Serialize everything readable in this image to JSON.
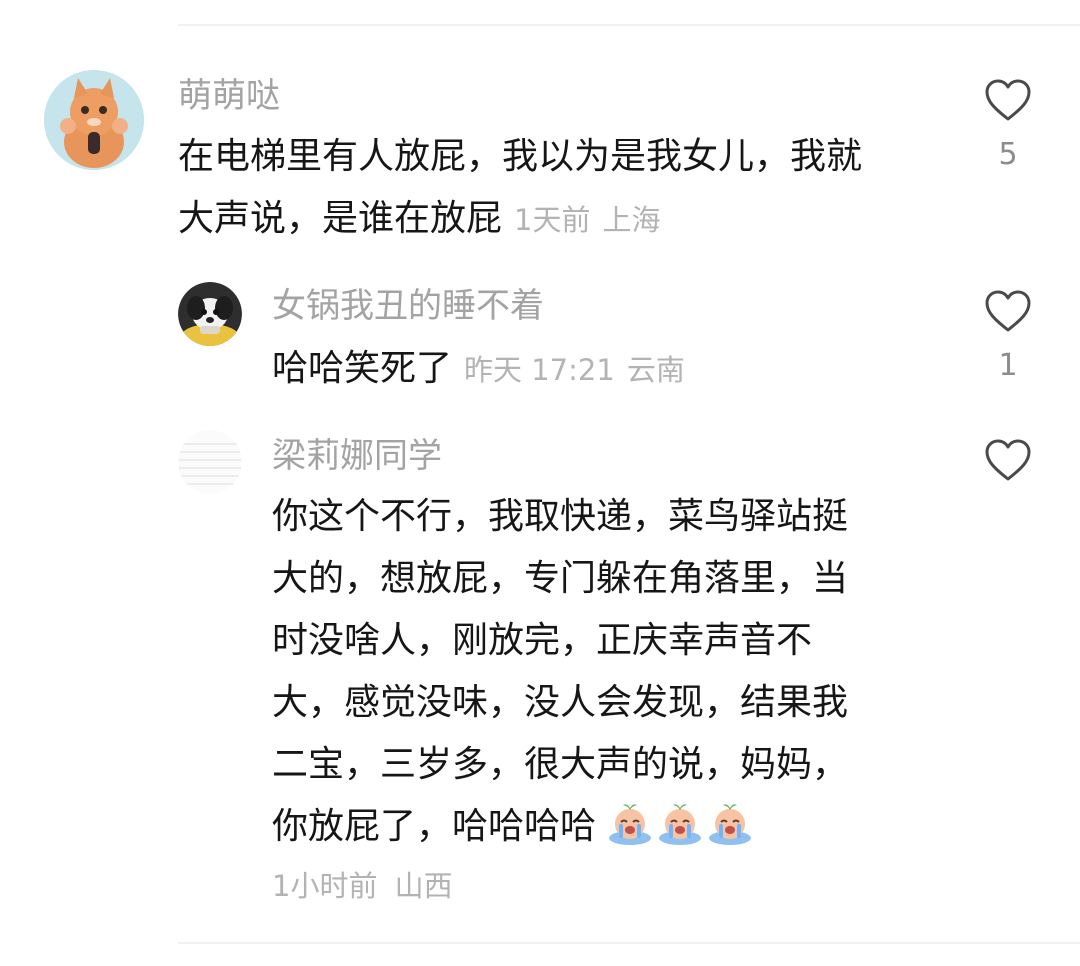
{
  "comments": [
    {
      "username": "萌萌哒",
      "text_lines": [
        "在电梯里有人放屁，我以为是我女儿，我就",
        "大声说，是谁在放屁"
      ],
      "time": "1天前",
      "location": "上海",
      "likes": "5",
      "avatar_icon": "cat-avatar-icon"
    },
    {
      "username": "女锅我丑的睡不着",
      "text_lines": [
        "哈哈笑死了"
      ],
      "time": "昨天 17:21",
      "location": "云南",
      "likes": "1",
      "avatar_icon": "puppy-avatar-icon"
    },
    {
      "username": "梁莉娜同学",
      "text_lines": [
        "你这个不行，我取快递，菜鸟驿站挺",
        "大的，想放屁，专门躲在角落里，当",
        "时没啥人，刚放完，正庆幸声音不",
        "大，感觉没味，没人会发现，结果我",
        "二宝，三岁多，很大声的说，妈妈，",
        "你放屁了，哈哈哈哈"
      ],
      "time": "1小时前",
      "location": "山西",
      "likes": "",
      "emoji_icon": "crying-laughing-emoji-icon"
    }
  ],
  "colors": {
    "username": "#a3a3a3",
    "text": "#161616",
    "meta": "#b3b3b3",
    "divider": "#f1f1f1"
  }
}
